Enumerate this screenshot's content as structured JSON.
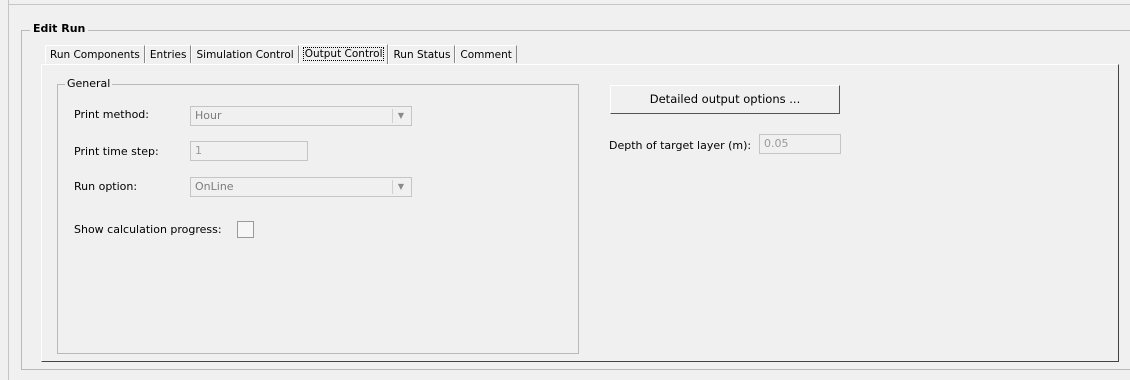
{
  "group": {
    "title": "Edit Run"
  },
  "tabs": [
    {
      "label": "Run Components",
      "active": false
    },
    {
      "label": "Entries",
      "active": false
    },
    {
      "label": "Simulation Control",
      "active": false
    },
    {
      "label": "Output Control",
      "active": true
    },
    {
      "label": "Run Status",
      "active": false
    },
    {
      "label": "Comment",
      "active": false
    }
  ],
  "general": {
    "title": "General",
    "print_method": {
      "label": "Print method:",
      "value": "Hour"
    },
    "print_time_step": {
      "label": "Print time step:",
      "value": "1"
    },
    "run_option": {
      "label": "Run option:",
      "value": "OnLine"
    },
    "show_progress": {
      "label": "Show calculation progress:",
      "checked": false
    }
  },
  "output": {
    "detailed_button": "Detailed output options ...",
    "depth": {
      "label": "Depth of target layer (m):",
      "value": "0.05"
    }
  },
  "icons": {
    "dropdown": "chevron-down-icon"
  }
}
